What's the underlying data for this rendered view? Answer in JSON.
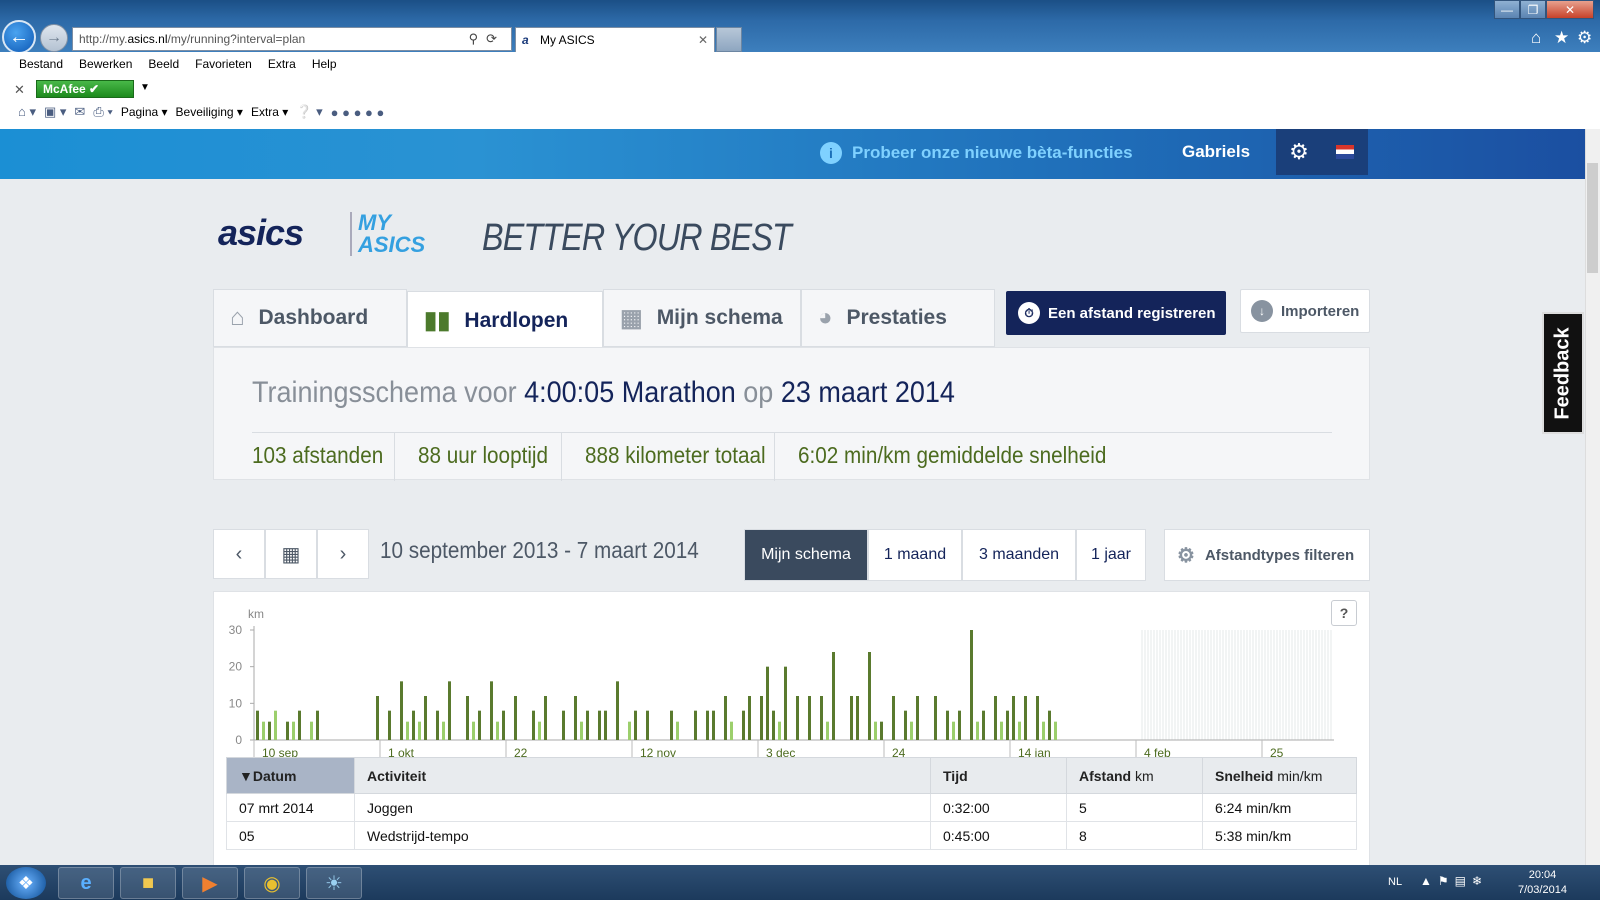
{
  "browser": {
    "url_prefix": "http://my.",
    "url_domain": "asics.nl",
    "url_path": "/my/running?interval=plan",
    "tab_title": "My ASICS",
    "menu": [
      "Bestand",
      "Bewerken",
      "Beeld",
      "Favorieten",
      "Extra",
      "Help"
    ],
    "mcafee": "McAfee",
    "cmd": {
      "pagina": "Pagina",
      "beveiliging": "Beveiliging",
      "extra": "Extra"
    }
  },
  "site": {
    "beta": "Probeer onze nieuwe bèta-functies",
    "user": "Gabriels",
    "logo": "asics",
    "logo_my": "MY",
    "logo_asics": "ASICS",
    "tagline": "BETTER YOUR BEST",
    "tabs": {
      "dashboard": "Dashboard",
      "running": "Hardlopen",
      "schedule": "Mijn schema",
      "performance": "Prestaties"
    },
    "register": "Een afstand registreren",
    "import": "Importeren",
    "feedback": "Feedback"
  },
  "summary": {
    "prefix": "Trainingsschema voor",
    "goal": "4:00:05 Marathon",
    "on": "op",
    "date": "23 maart 2014",
    "stats": [
      "103 afstanden",
      "88 uur looptijd",
      "888 kilometer totaal",
      "6:02 min/km gemiddelde snelheid"
    ]
  },
  "controls": {
    "range": "10 september 2013 - 7 maart 2014",
    "periods": [
      "Mijn schema",
      "1 maand",
      "3 maanden",
      "1 jaar"
    ],
    "filter": "Afstandtypes filteren"
  },
  "chart_data": {
    "type": "bar",
    "ylabel": "km",
    "ylim": [
      0,
      30
    ],
    "yticks": [
      0,
      10,
      20,
      30
    ],
    "xticks": [
      "10 sep",
      "1 okt",
      "22",
      "12 nov",
      "3 dec",
      "24",
      "14 jan",
      "4 feb",
      "25"
    ],
    "x_unit": "day index from 10 sep 2013",
    "series": [
      {
        "name": "dark",
        "color": "#5a7a2e",
        "days": [
          0,
          2,
          5,
          7,
          10,
          20,
          22,
          24,
          26,
          28,
          30,
          32,
          35,
          37,
          39,
          41,
          43,
          46,
          48,
          51,
          53,
          55,
          57,
          58,
          60,
          63,
          65,
          69,
          73,
          75,
          76,
          78,
          81,
          82,
          84,
          85,
          86,
          88,
          90,
          92,
          94,
          96,
          99,
          100,
          102,
          104,
          106,
          108,
          110,
          113,
          115,
          117,
          119,
          121,
          123,
          125,
          126,
          128,
          130,
          132
        ],
        "values": [
          8,
          5,
          5,
          8,
          8,
          12,
          8,
          16,
          8,
          12,
          8,
          16,
          12,
          8,
          16,
          8,
          12,
          8,
          12,
          8,
          12,
          8,
          8,
          8,
          16,
          8,
          8,
          8,
          8,
          8,
          8,
          12,
          8,
          12,
          12,
          20,
          8,
          20,
          12,
          12,
          12,
          24,
          12,
          12,
          24,
          5,
          12,
          8,
          12,
          12,
          8,
          8,
          30,
          8,
          12,
          8,
          12,
          12,
          12,
          8
        ],
        "notes": "dark green bars = completed runs"
      },
      {
        "name": "light",
        "color": "#9ccf6c",
        "days": [
          1,
          3,
          6,
          9,
          25,
          27,
          31,
          36,
          40,
          47,
          54,
          62,
          70,
          79,
          87,
          95,
          103,
          109,
          116,
          120,
          124,
          127,
          131,
          133
        ],
        "values": [
          5,
          8,
          5,
          5,
          5,
          5,
          5,
          5,
          5,
          5,
          5,
          5,
          5,
          5,
          5,
          5,
          5,
          5,
          5,
          5,
          5,
          5,
          5,
          5
        ],
        "notes": "light green bars = planned runs"
      }
    ],
    "future_start_day": 148,
    "total_days": 180,
    "grid": false
  },
  "table": {
    "headers": {
      "date": "Datum",
      "activity": "Activiteit",
      "time": "Tijd",
      "distance": "Afstand",
      "distance_unit": "km",
      "speed": "Snelheid",
      "speed_unit": "min/km"
    },
    "rows": [
      {
        "date": "07 mrt 2014",
        "activity": "Joggen",
        "time": "0:32:00",
        "distance": "5",
        "speed": "6:24 min/km"
      },
      {
        "date": "05",
        "activity": "Wedstrijd-tempo",
        "time": "0:45:00",
        "distance": "8",
        "speed": "5:38 min/km"
      }
    ]
  },
  "taskbar": {
    "lang": "NL",
    "time": "20:04",
    "date": "7/03/2014"
  }
}
